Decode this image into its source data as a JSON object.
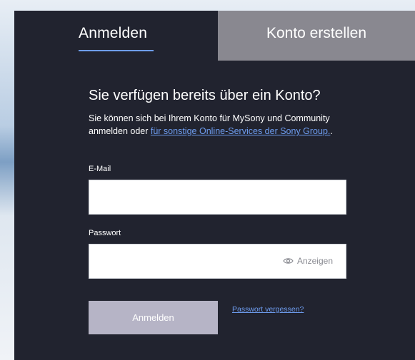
{
  "tabs": {
    "signin_label": "Anmelden",
    "create_label": "Konto erstellen"
  },
  "form": {
    "heading": "Sie verfügen bereits über ein Konto?",
    "desc_text": "Sie können sich bei Ihrem Konto für MySony und Community anmelden oder ",
    "desc_link": "für sonstige Online-Services der Sony Group.",
    "desc_end": ".",
    "email_label": "E-Mail",
    "email_value": "",
    "password_label": "Passwort",
    "password_value": "",
    "show_label": "Anzeigen",
    "submit_label": "Anmelden",
    "forgot_label": "Passwort vergessen?"
  },
  "colors": {
    "panel": "#21232f",
    "accent": "#6e9df0",
    "inactive_tab": "#898890",
    "button": "#b6b4c6"
  },
  "icons": {
    "show_password": "eye-icon"
  }
}
